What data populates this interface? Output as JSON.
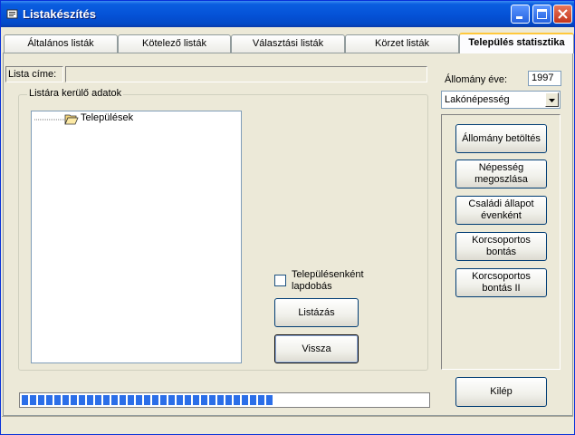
{
  "window": {
    "title": "Listakészítés"
  },
  "tabs": [
    {
      "label": "Általános listák"
    },
    {
      "label": "Kötelező listák"
    },
    {
      "label": "Választási listák"
    },
    {
      "label": "Körzet listák"
    },
    {
      "label": "Település statisztika"
    }
  ],
  "list_title": {
    "label": "Lista címe:",
    "value": ""
  },
  "group": {
    "caption": "Listára kerülő adatok"
  },
  "tree": {
    "root": "Települések"
  },
  "checkbox": {
    "label_line1": "Településenként",
    "label_line2": "lapdobás",
    "checked": false
  },
  "buttons": {
    "listazas": "Listázás",
    "vissza": "Vissza",
    "allomany_betoltes": "Állomány betöltés",
    "nepesseg_line1": "Népesség",
    "nepesseg_line2": "megoszlása",
    "csaladi_line1": "Családi állapot",
    "csaladi_line2": "évenként",
    "korcs1_line1": "Korcsoportos",
    "korcs1_line2": "bontás",
    "korcs2_line1": "Korcsoportos",
    "korcs2_line2": "bontás II",
    "kilep": "Kilép"
  },
  "allomany": {
    "label": "Állomány éve:",
    "year": "1997"
  },
  "dropdown": {
    "selected": "Lakónépesség"
  },
  "progress": {
    "fraction": 0.62,
    "color": "#2b6ee8"
  }
}
